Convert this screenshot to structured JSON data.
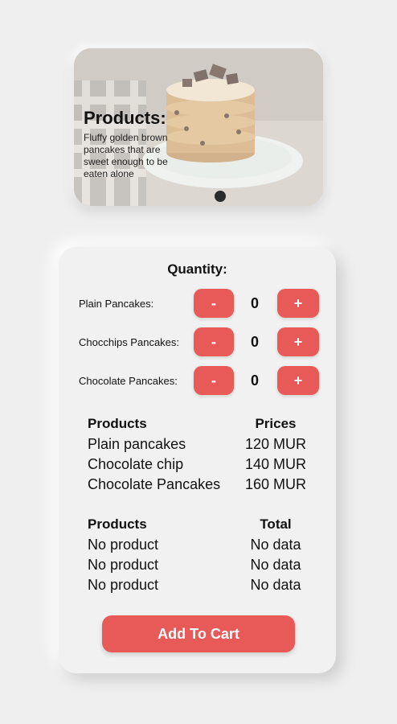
{
  "hero": {
    "title": "Products:",
    "description": "Fluffy golden brown pancakes that are sweet enough to be eaten alone"
  },
  "quantity": {
    "title": "Quantity:",
    "rows": [
      {
        "label": "Plain Pancakes:",
        "minus": "-",
        "value": "0",
        "plus": "+"
      },
      {
        "label": "Chocchips Pancakes:",
        "minus": "-",
        "value": "0",
        "plus": "+"
      },
      {
        "label": "Chocolate Pancakes:",
        "minus": "-",
        "value": "0",
        "plus": "+"
      }
    ]
  },
  "prices_table": {
    "headers": [
      "Products",
      "Prices"
    ],
    "rows": [
      [
        "Plain pancakes",
        "120 MUR"
      ],
      [
        "Chocolate chip",
        "140 MUR"
      ],
      [
        "Chocolate Pancakes",
        "160 MUR"
      ]
    ]
  },
  "totals_table": {
    "headers": [
      "Products",
      "Total"
    ],
    "rows": [
      [
        "No product",
        "No data"
      ],
      [
        "No product",
        "No data"
      ],
      [
        "No product",
        "No data"
      ]
    ]
  },
  "add_to_cart_label": "Add To Cart",
  "colors": {
    "accent": "#e85a57",
    "background": "#efefef",
    "card": "#f1f1f1"
  }
}
